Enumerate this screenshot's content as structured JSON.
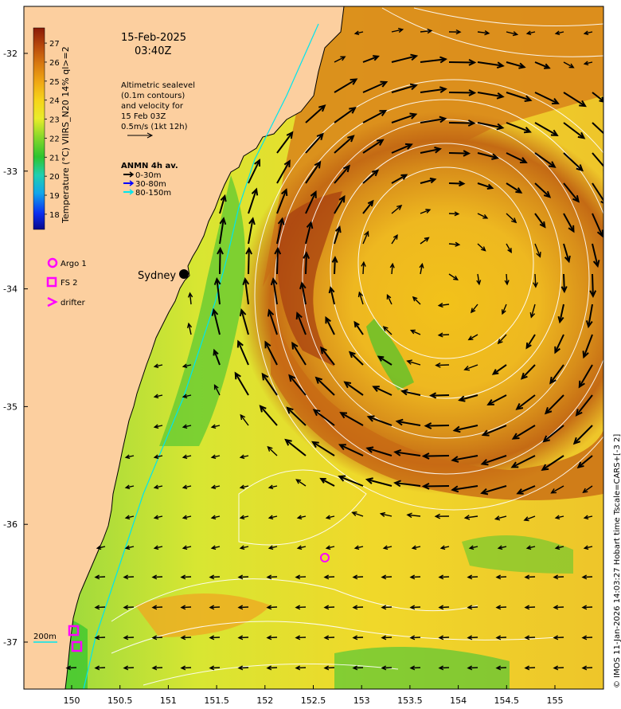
{
  "header": {
    "date": "15-Feb-2025",
    "time": "03:40Z"
  },
  "altimetry_note": {
    "lines": [
      "Altimetric sealevel",
      "(0.1m contours)",
      "and velocity for",
      "15 Feb 03Z",
      "0.5m/s (1kt 12h)"
    ]
  },
  "anmn_legend": {
    "title": "ANMN 4h av.",
    "items": [
      {
        "label": "0-30m",
        "color": "#000000"
      },
      {
        "label": "30-80m",
        "color": "#0000ff"
      },
      {
        "label": "80-150m",
        "color": "#00e5ee"
      }
    ]
  },
  "colorbar": {
    "label": "Temperature (°C) VIIRS_N20 14% ql>=2",
    "ticks": [
      "27",
      "26",
      "25",
      "24",
      "23",
      "22",
      "21",
      "20",
      "19",
      "18"
    ],
    "range": [
      17.2,
      27.8
    ]
  },
  "markers_legend": {
    "argo": "Argo 1",
    "fs": "FS 2",
    "drifter": "drifter",
    "color": "#ff00ff"
  },
  "city": "Sydney",
  "isobath_label": "200m",
  "axes": {
    "x_ticks": [
      "150",
      "150.5",
      "151",
      "151.5",
      "152",
      "152.5",
      "153",
      "153.5",
      "154",
      "154.5",
      "155"
    ],
    "y_ticks": [
      "-32",
      "-33",
      "-34",
      "-35",
      "-36",
      "-37"
    ]
  },
  "credit": "© IMOS 11-Jan-2026 14:03:27 Hobart time Tscale=CARS+[-3 2]",
  "colors": {
    "land": "#fccf9f",
    "coastline": "#000000",
    "contour": "#ffffff",
    "isobath": "#00e5ee"
  }
}
